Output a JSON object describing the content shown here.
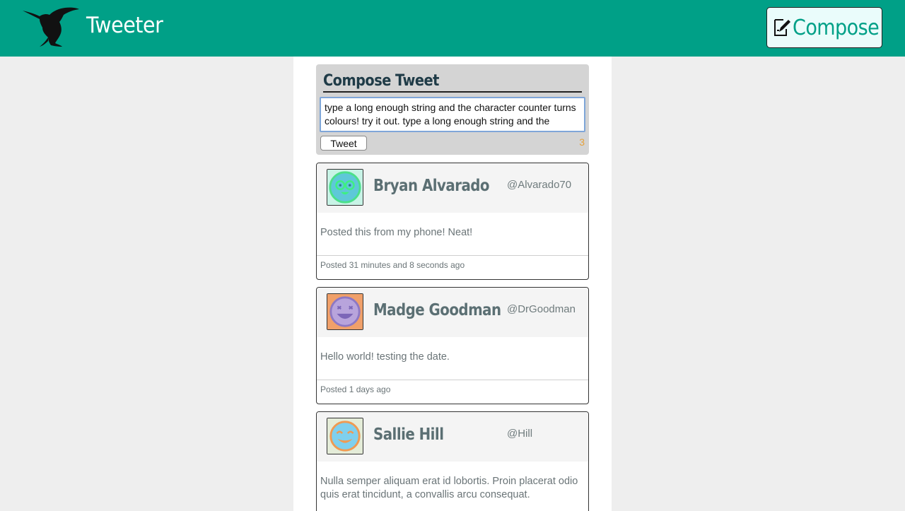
{
  "header": {
    "brand": "Tweeter",
    "compose_label": "Compose",
    "background": "#00a087"
  },
  "composer": {
    "title": "Compose Tweet",
    "text": "type a long enough string and the character counter turns colours! try it out. type a long enough string and the",
    "button_label": "Tweet",
    "counter": "3"
  },
  "tweets": [
    {
      "name": "Bryan Alvarado",
      "handle": "@Alvarado70",
      "body": "Posted this from my phone! Neat!",
      "footer": "Posted 31 minutes and 8 seconds ago",
      "avatar_icon": "glasses-face-icon"
    },
    {
      "name": "Madge Goodman",
      "handle": "@DrGoodman",
      "body": "Hello world! testing the date.",
      "footer": "Posted 1 days ago",
      "avatar_icon": "laughing-face-icon"
    },
    {
      "name": "Sallie Hill",
      "handle": "@Hill",
      "body": "Nulla semper aliquam erat id lobortis. Proin placerat odio quis erat tincidunt, a convallis arcu consequat.",
      "footer": "",
      "avatar_icon": "winking-face-icon"
    }
  ]
}
